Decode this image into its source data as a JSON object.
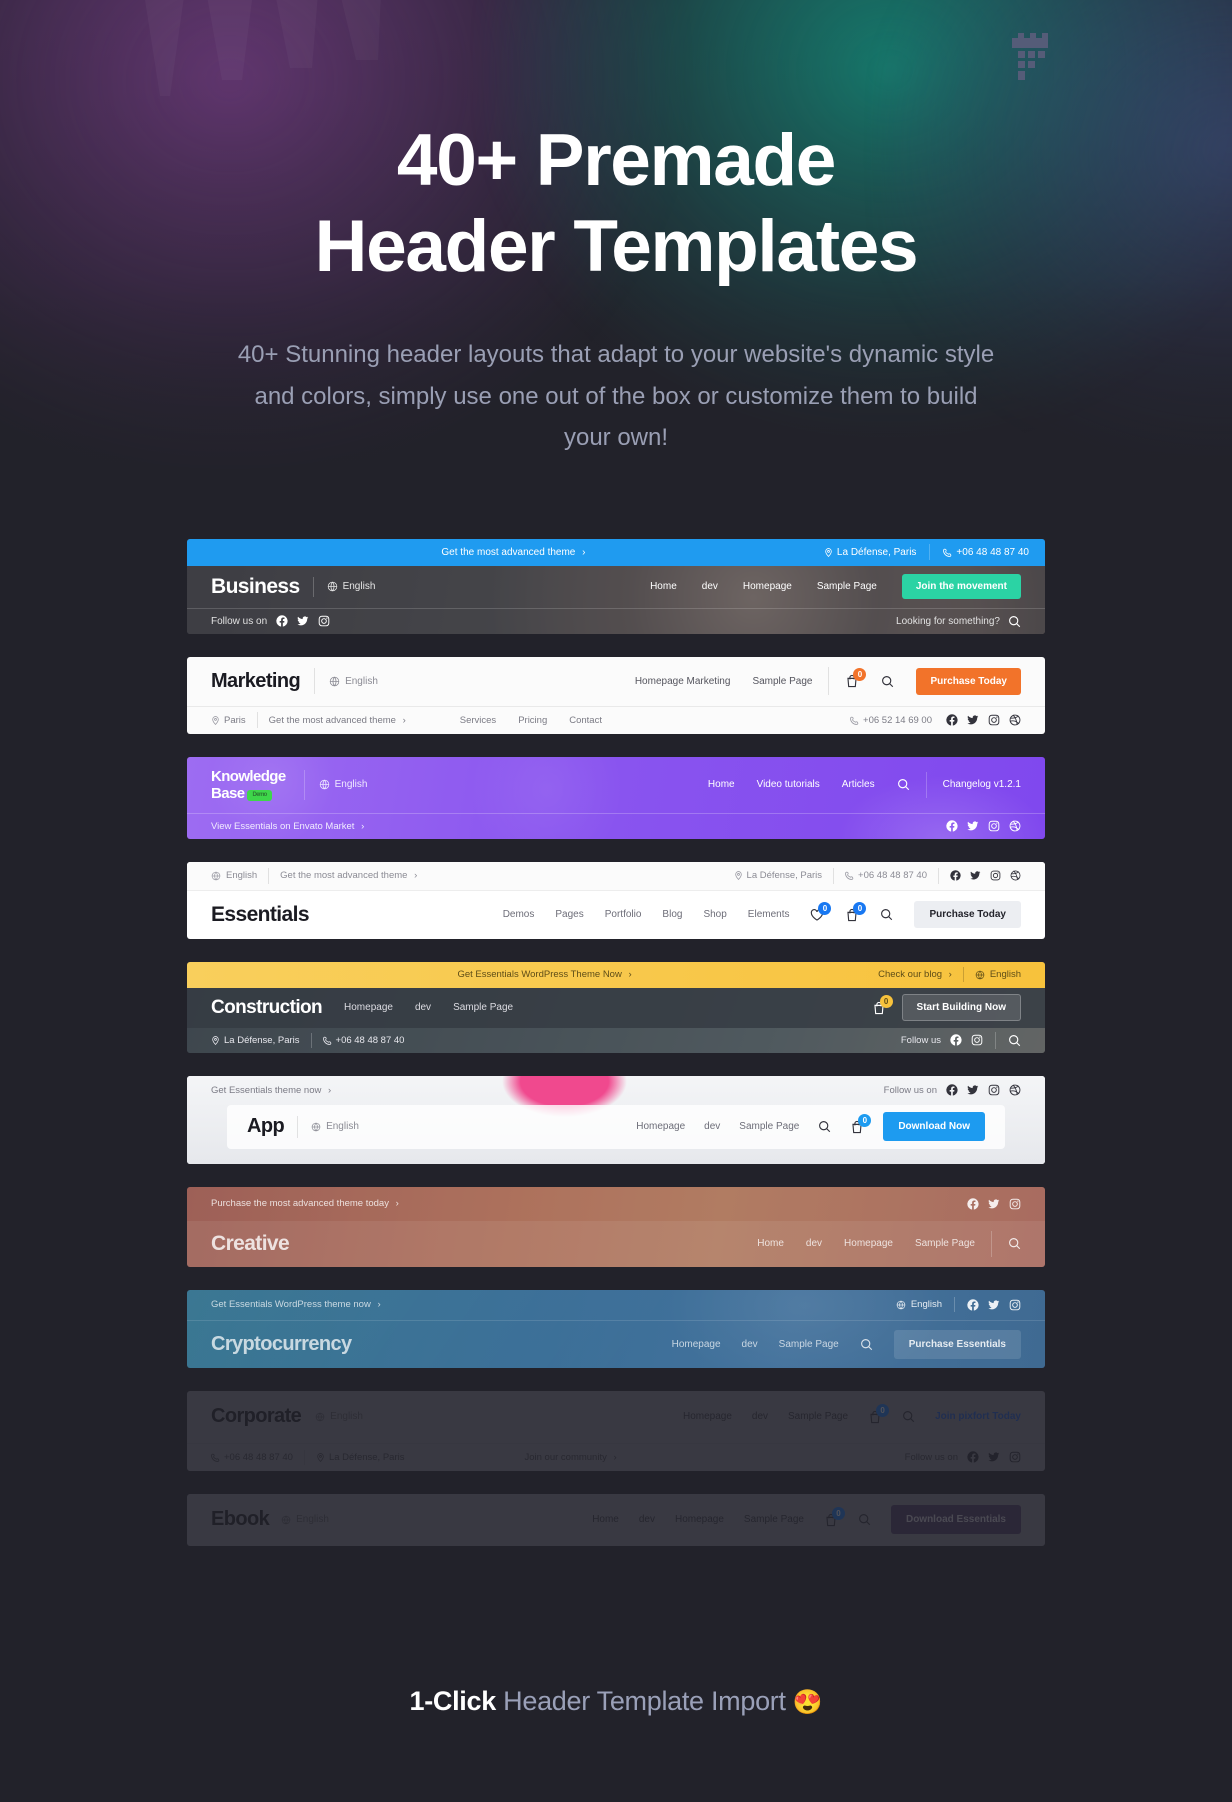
{
  "brand": {
    "logo_name": "pixfort-tower-logo"
  },
  "hero": {
    "title_line1": "40+ Premade",
    "title_line2": "Header Templates",
    "subtitle": "40+ Stunning header layouts that adapt to your website's dynamic style and colors, simply use one out of the box or customize them to build your own!"
  },
  "overlay": {
    "strong": "1-Click",
    "rest": " Header Template Import ",
    "emoji": "😍"
  },
  "colors": {
    "page_bg": "#22222a",
    "business_topbar": "#1f9bf0",
    "business_cta": "#2bd3a4",
    "marketing_cta": "#f2732a",
    "knowledge_bg": "#8b55f0",
    "knowledge_badge": "#3ed64a",
    "essentials_badge": "#1878f2",
    "construction_topbar": "#f7c745",
    "app_cta": "#1d9bf0",
    "creative_bg": "#b9705f",
    "crypto_bg": "#3a6d93"
  },
  "cards": [
    {
      "name": "business",
      "topbar": {
        "promo": "Get the most advanced theme",
        "location": "La Défense, Paris",
        "phone": "+06 48 48 87 40"
      },
      "logo": "Business",
      "language": "English",
      "nav": [
        "Home",
        "dev",
        "Homepage",
        "Sample Page"
      ],
      "cta": "Join the movement",
      "bottombar": {
        "follow_label": "Follow us on",
        "search_label": "Looking for something?"
      },
      "socials": [
        "facebook",
        "twitter",
        "instagram"
      ]
    },
    {
      "name": "marketing",
      "logo": "Marketing",
      "language": "English",
      "nav": [
        "Homepage Marketing",
        "Sample Page"
      ],
      "cart_count": "0",
      "cta": "Purchase Today",
      "bottombar": {
        "location": "Paris",
        "promo": "Get the most advanced theme",
        "phone": "+06 52 14 69 00"
      },
      "nav2": [
        "Services",
        "Pricing",
        "Contact"
      ],
      "socials": [
        "facebook",
        "twitter",
        "instagram",
        "dribbble"
      ]
    },
    {
      "name": "knowledge-base",
      "logo_line1": "Knowledge",
      "logo_line2": "Base",
      "logo_badge": "Demo",
      "language": "English",
      "nav": [
        "Home",
        "Video tutorials",
        "Articles"
      ],
      "changelog": "Changelog v1.2.1",
      "bottombar": {
        "promo": "View Essentials on Envato Market"
      },
      "socials": [
        "facebook",
        "twitter",
        "instagram",
        "dribbble"
      ]
    },
    {
      "name": "essentials",
      "topbar": {
        "language": "English",
        "promo": "Get the most advanced theme",
        "location": "La Défense, Paris",
        "phone": "+06 48 48 87 40"
      },
      "logo": "Essentials",
      "nav": [
        "Demos",
        "Pages",
        "Portfolio",
        "Blog",
        "Shop",
        "Elements"
      ],
      "wishlist_count": "0",
      "cart_count": "0",
      "cta": "Purchase Today",
      "socials": [
        "facebook",
        "twitter",
        "instagram",
        "dribbble"
      ]
    },
    {
      "name": "construction",
      "topbar": {
        "promo": "Get Essentials WordPress Theme Now",
        "blog": "Check our blog",
        "language": "English"
      },
      "logo": "Construction",
      "nav": [
        "Homepage",
        "dev",
        "Sample Page"
      ],
      "cart_count": "0",
      "cta": "Start Building Now",
      "bottombar": {
        "location": "La Défense, Paris",
        "phone": "+06 48 48 87 40",
        "follow_label": "Follow us"
      },
      "socials": [
        "facebook",
        "instagram"
      ]
    },
    {
      "name": "app",
      "topbar": {
        "promo": "Get Essentials theme now",
        "follow_label": "Follow us on"
      },
      "logo": "App",
      "language": "English",
      "nav": [
        "Homepage",
        "dev",
        "Sample Page"
      ],
      "cart_count": "0",
      "cta": "Download Now",
      "socials": [
        "facebook",
        "twitter",
        "instagram",
        "dribbble"
      ]
    },
    {
      "name": "creative",
      "topbar": {
        "promo": "Purchase the most advanced theme today"
      },
      "logo": "Creative",
      "nav": [
        "Home",
        "dev",
        "Homepage",
        "Sample Page"
      ],
      "socials": [
        "facebook",
        "twitter",
        "instagram"
      ]
    },
    {
      "name": "cryptocurrency",
      "topbar": {
        "promo": "Get Essentials WordPress theme now",
        "language": "English"
      },
      "logo": "Cryptocurrency",
      "nav": [
        "Homepage",
        "dev",
        "Sample Page"
      ],
      "cta": "Purchase Essentials",
      "socials": [
        "facebook",
        "twitter",
        "instagram"
      ]
    },
    {
      "name": "corporate",
      "logo": "Corporate",
      "language": "English",
      "nav": [
        "Homepage",
        "dev",
        "Sample Page"
      ],
      "cart_count": "0",
      "cta": "Join pixfort Today",
      "bottombar": {
        "phone": "+06 48 48 87 40",
        "location": "La Défense, Paris",
        "promo": "Join our community",
        "follow_label": "Follow us on"
      },
      "socials": [
        "facebook",
        "twitter",
        "instagram"
      ]
    },
    {
      "name": "ebook",
      "logo": "Ebook",
      "language": "English",
      "nav": [
        "Home",
        "dev",
        "Homepage",
        "Sample Page"
      ],
      "cart_count": "0",
      "cta": "Download Essentials"
    }
  ]
}
